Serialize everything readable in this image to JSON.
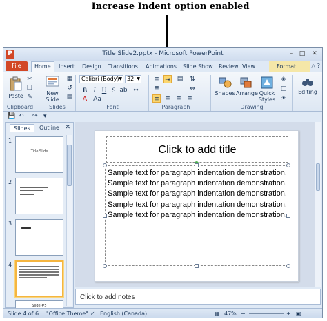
{
  "annotation": {
    "text": "Increase Indent option enabled"
  },
  "window": {
    "title": "Title Slide2.pptx - Microsoft PowerPoint",
    "app_icon": "P"
  },
  "ribbon_tabs": {
    "file": "File",
    "home": "Home",
    "insert": "Insert",
    "design": "Design",
    "transitions": "Transitions",
    "animations": "Animations",
    "slideshow": "Slide Show",
    "review": "Review",
    "view": "View",
    "format": "Format"
  },
  "ribbon": {
    "paste": "Paste",
    "new_slide": "New Slide",
    "font_name": "Calibri (Body)",
    "font_size": "32",
    "shapes": "Shapes",
    "arrange": "Arrange",
    "quick_styles": "Quick Styles",
    "editing": "Editing",
    "groups": {
      "clipboard": "Clipboard",
      "slides": "Slides",
      "font": "Font",
      "paragraph": "Paragraph",
      "drawing": "Drawing"
    }
  },
  "panel": {
    "slides_tab": "Slides",
    "outline_tab": "Outline",
    "thumbs": [
      {
        "num": "1",
        "text": "Title Slide"
      },
      {
        "num": "2",
        "text": ""
      },
      {
        "num": "3",
        "text": ""
      },
      {
        "num": "4",
        "text": ""
      },
      {
        "num": "",
        "text": "Slide #5"
      }
    ]
  },
  "slide": {
    "title_placeholder": "Click to add title",
    "body_text": "Sample text for paragraph indentation demonstration. Sample text for paragraph indentation demonstration. Sample text for paragraph indentation demonstration. Sample text for paragraph indentation demonstration. Sample text for paragraph indentation demonstration."
  },
  "notes": {
    "placeholder": "Click to add notes"
  },
  "status": {
    "slide_info": "Slide 4 of 6",
    "theme": "\"Office Theme\"",
    "language": "English (Canada)",
    "zoom": "47%"
  },
  "accent": {
    "file_tab": "#d24726",
    "highlight": "#fbd66e"
  }
}
